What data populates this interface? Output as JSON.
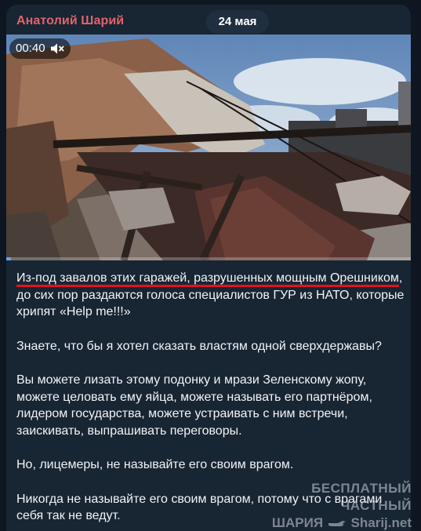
{
  "message": {
    "author": "Анатолий Шарий",
    "date": "24 мая",
    "video": {
      "time": "00:40",
      "muted": true,
      "progress_percent": 1.2,
      "icon": "volume-mute-icon"
    },
    "paragraphs": [
      {
        "underlined": "Из-под завалов этих гаражей, разрушенных мощным Орешником",
        "rest": ", до сих пор раздаются голоса специалистов ГУР из НАТО, которые хрипят «Help me!!!»"
      },
      {
        "text": "Знаете, что бы я хотел сказать властям одной сверхдержавы?"
      },
      {
        "text": "Вы можете лизать этому подонку и мрази Зеленскому жопу, можете целовать ему яйца, можете называть его партнёром, лидером государства, можете устраивать с ним встречи, заискивать, выпрашивать переговоры."
      },
      {
        "text": "Но, лицемеры, не называйте его своим врагом."
      },
      {
        "text": "Никогда не называйте его своим врагом, потому что с врагами себя так не ведут."
      }
    ]
  },
  "watermark": {
    "line1": "БЕСПЛАТНЫЙ ЧАСТНЫЙ",
    "line2_left": "ШАРИЯ",
    "line2_right": "Sharij.net"
  },
  "colors": {
    "background": "#0e1621",
    "bubble": "#182533",
    "author": "#e0646b",
    "text": "#f2f4f7",
    "underline": "#e0141b",
    "progress": "#5fa8e8"
  }
}
